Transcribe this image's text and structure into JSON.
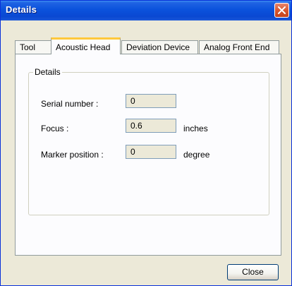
{
  "window": {
    "title": "Details"
  },
  "tabs": [
    {
      "label": "Tool"
    },
    {
      "label": "Acoustic Head"
    },
    {
      "label": "Deviation Device"
    },
    {
      "label": "Analog Front End"
    }
  ],
  "group": {
    "title": "Details",
    "fields": [
      {
        "label": "Serial number :",
        "value": "0",
        "unit": ""
      },
      {
        "label": "Focus :",
        "value": "0.6",
        "unit": "inches"
      },
      {
        "label": "Marker position :",
        "value": "0",
        "unit": "degree"
      }
    ]
  },
  "buttons": {
    "close": "Close"
  },
  "icons": {
    "close": "close-icon"
  },
  "colors": {
    "titlebar": "#0b52dc",
    "active_tab_accent": "#ffc83c",
    "window_bg": "#ece9d8"
  }
}
